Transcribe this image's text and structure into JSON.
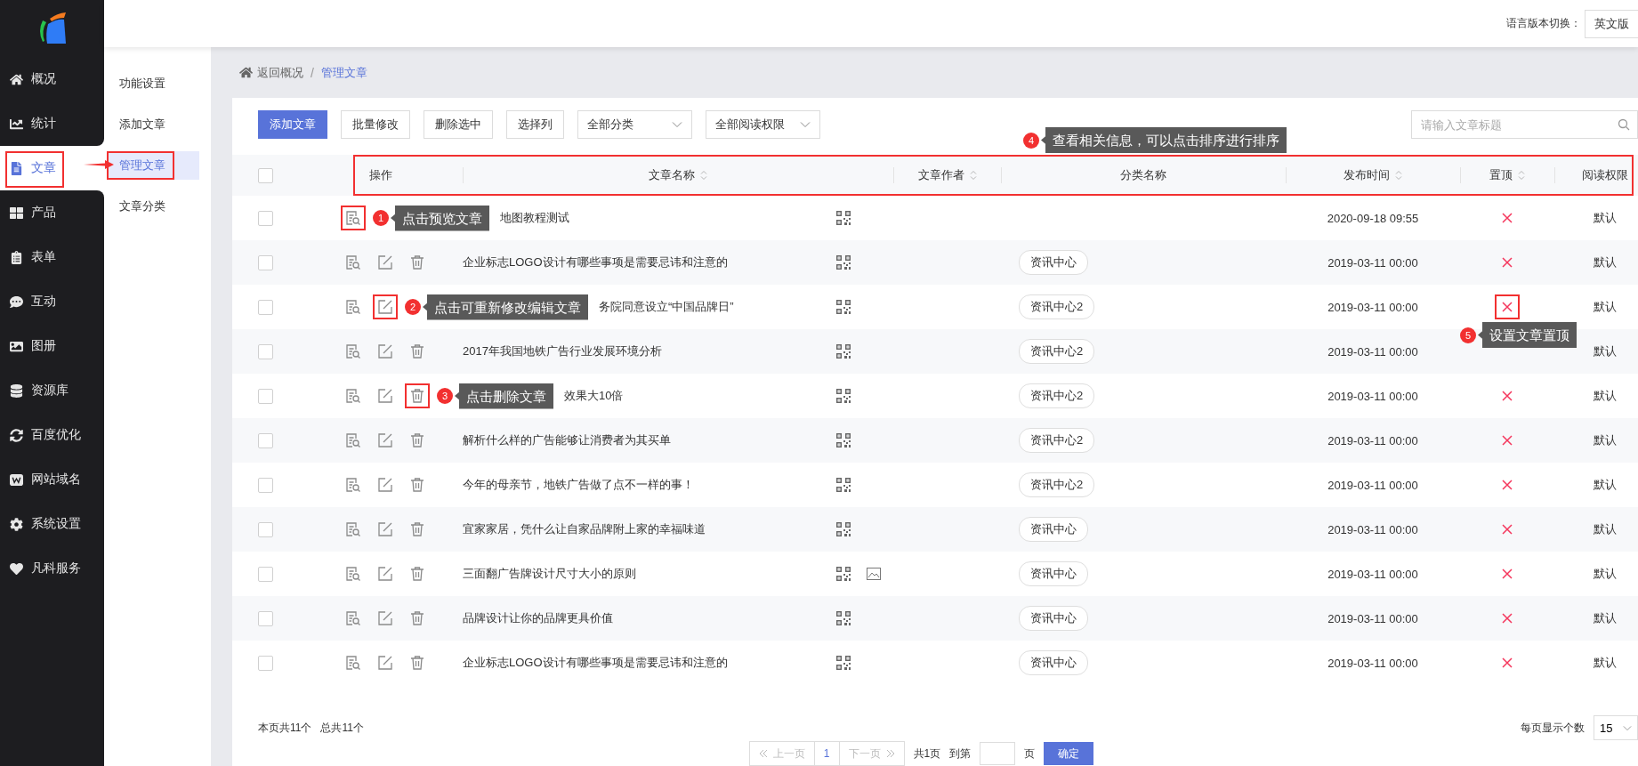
{
  "sidebar": {
    "items": [
      {
        "label": "概况",
        "selected": false,
        "highlighted": false
      },
      {
        "label": "统计",
        "selected": false,
        "highlighted": false
      },
      {
        "label": "文章",
        "selected": true,
        "highlighted": true
      },
      {
        "label": "产品",
        "selected": false,
        "highlighted": false
      },
      {
        "label": "表单",
        "selected": false,
        "highlighted": false
      },
      {
        "label": "互动",
        "selected": false,
        "highlighted": false
      },
      {
        "label": "图册",
        "selected": false,
        "highlighted": false
      },
      {
        "label": "资源库",
        "selected": false,
        "highlighted": false
      },
      {
        "label": "百度优化",
        "selected": false,
        "highlighted": false
      },
      {
        "label": "网站域名",
        "selected": false,
        "highlighted": false
      },
      {
        "label": "系统设置",
        "selected": false,
        "highlighted": false
      },
      {
        "label": "凡科服务",
        "selected": false,
        "highlighted": false
      }
    ]
  },
  "submenu": {
    "items": [
      {
        "label": "功能设置",
        "selected": false,
        "highlighted": false
      },
      {
        "label": "添加文章",
        "selected": false,
        "highlighted": false
      },
      {
        "label": "管理文章",
        "selected": true,
        "highlighted": true
      },
      {
        "label": "文章分类",
        "selected": false,
        "highlighted": false
      }
    ]
  },
  "topbar": {
    "language_label": "语言版本切换：",
    "language_value": "英文版"
  },
  "breadcrumb": {
    "home": "返回概况",
    "separator": "/",
    "current": "管理文章"
  },
  "toolbar": {
    "buttons": [
      {
        "label": "添加文章",
        "primary": true
      },
      {
        "label": "批量修改",
        "primary": false
      },
      {
        "label": "删除选中",
        "primary": false
      },
      {
        "label": "选择列",
        "primary": false
      }
    ],
    "filters": [
      {
        "label": "全部分类"
      },
      {
        "label": "全部阅读权限"
      }
    ],
    "search": {
      "placeholder": "请输入文章标题"
    },
    "callout": {
      "number": "4",
      "text": "查看相关信息，可以点击排序进行排序"
    }
  },
  "table": {
    "all_checked": false,
    "header_highlighted": true,
    "columns": [
      {
        "label": "操作",
        "sortable": false
      },
      {
        "label": "文章名称",
        "sortable": true
      },
      {
        "label": "文章作者",
        "sortable": true
      },
      {
        "label": "分类名称",
        "sortable": false
      },
      {
        "label": "发布时间",
        "sortable": true
      },
      {
        "label": "置顶",
        "sortable": true
      },
      {
        "label": "阅读权限",
        "sortable": false
      }
    ],
    "rows": [
      {
        "checked": false,
        "actions": [
          {
            "kind": "preview",
            "highlighted": true
          }
        ],
        "callout": {
          "number": "1",
          "text": "点击预览文章"
        },
        "title": "地图教程测试",
        "has_image": false,
        "date": "2020-09-18 09:55",
        "pinned": false,
        "access": "默认"
      },
      {
        "checked": false,
        "actions": [
          {
            "kind": "preview",
            "highlighted": false
          },
          {
            "kind": "edit",
            "highlighted": false
          },
          {
            "kind": "delete",
            "highlighted": false
          }
        ],
        "title": "企业标志LOGO设计有哪些事项是需要忌讳和注意的",
        "has_image": false,
        "category": "资讯中心",
        "date": "2019-03-11 00:00",
        "pinned": false,
        "access": "默认"
      },
      {
        "checked": false,
        "actions": [
          {
            "kind": "preview",
            "highlighted": false
          },
          {
            "kind": "edit",
            "highlighted": true
          }
        ],
        "callout": {
          "number": "2",
          "text": "点击可重新修改编辑文章"
        },
        "title": "务院同意设立“中国品牌日”",
        "has_image": false,
        "category": "资讯中心2",
        "date": "2019-03-11 00:00",
        "pinned": false,
        "pin_highlighted": true,
        "pin_callout": {
          "number": "5",
          "text": "设置文章置顶"
        },
        "access": "默认"
      },
      {
        "checked": false,
        "actions": [
          {
            "kind": "preview",
            "highlighted": false
          },
          {
            "kind": "edit",
            "highlighted": false
          },
          {
            "kind": "delete",
            "highlighted": false
          }
        ],
        "title": "2017年我国地铁广告行业发展环境分析",
        "has_image": false,
        "category": "资讯中心2",
        "date": "2019-03-11 00:00",
        "access": "默认"
      },
      {
        "checked": false,
        "actions": [
          {
            "kind": "preview",
            "highlighted": false
          },
          {
            "kind": "edit",
            "highlighted": false
          },
          {
            "kind": "delete",
            "highlighted": true
          }
        ],
        "callout": {
          "number": "3",
          "text": "点击删除文章"
        },
        "title": "效果大10倍",
        "has_image": false,
        "category": "资讯中心2",
        "date": "2019-03-11 00:00",
        "pinned": false,
        "access": "默认"
      },
      {
        "checked": false,
        "actions": [
          {
            "kind": "preview",
            "highlighted": false
          },
          {
            "kind": "edit",
            "highlighted": false
          },
          {
            "kind": "delete",
            "highlighted": false
          }
        ],
        "title": "解析什么样的广告能够让消费者为其买单",
        "has_image": false,
        "category": "资讯中心2",
        "date": "2019-03-11 00:00",
        "pinned": false,
        "access": "默认"
      },
      {
        "checked": false,
        "actions": [
          {
            "kind": "preview",
            "highlighted": false
          },
          {
            "kind": "edit",
            "highlighted": false
          },
          {
            "kind": "delete",
            "highlighted": false
          }
        ],
        "title": "今年的母亲节，地铁广告做了点不一样的事！",
        "has_image": false,
        "category": "资讯中心2",
        "date": "2019-03-11 00:00",
        "pinned": false,
        "access": "默认"
      },
      {
        "checked": false,
        "actions": [
          {
            "kind": "preview",
            "highlighted": false
          },
          {
            "kind": "edit",
            "highlighted": false
          },
          {
            "kind": "delete",
            "highlighted": false
          }
        ],
        "title": "宜家家居，凭什么让自家品牌附上家的幸福味道",
        "has_image": false,
        "category": "资讯中心",
        "date": "2019-03-11 00:00",
        "pinned": false,
        "access": "默认"
      },
      {
        "checked": false,
        "actions": [
          {
            "kind": "preview",
            "highlighted": false
          },
          {
            "kind": "edit",
            "highlighted": false
          },
          {
            "kind": "delete",
            "highlighted": false
          }
        ],
        "title": "三面翻广告牌设计尺寸大小的原则",
        "has_image": true,
        "category": "资讯中心",
        "date": "2019-03-11 00:00",
        "pinned": false,
        "access": "默认"
      },
      {
        "checked": false,
        "actions": [
          {
            "kind": "preview",
            "highlighted": false
          },
          {
            "kind": "edit",
            "highlighted": false
          },
          {
            "kind": "delete",
            "highlighted": false
          }
        ],
        "title": "品牌设计让你的品牌更具价值",
        "has_image": false,
        "category": "资讯中心",
        "date": "2019-03-11 00:00",
        "pinned": false,
        "access": "默认"
      },
      {
        "checked": false,
        "actions": [
          {
            "kind": "preview",
            "highlighted": false
          },
          {
            "kind": "edit",
            "highlighted": false
          },
          {
            "kind": "delete",
            "highlighted": false
          }
        ],
        "title": "企业标志LOGO设计有哪些事项是需要忌讳和注意的",
        "has_image": false,
        "category": "资讯中心",
        "date": "2019-03-11 00:00",
        "pinned": false,
        "access": "默认"
      }
    ]
  },
  "footer": {
    "page_info": "本页共11个",
    "total_info": "总共11个",
    "per_page_label": "每页显示个数",
    "per_page": "15",
    "prev": {
      "label": "上一页",
      "disabled": true
    },
    "pages": [
      {
        "label": "1",
        "selected": true
      }
    ],
    "next": {
      "label": "下一页",
      "disabled": true
    },
    "page_total": "共1页",
    "goto_label": "到第",
    "goto_suffix": "页",
    "confirm": "确定"
  }
}
